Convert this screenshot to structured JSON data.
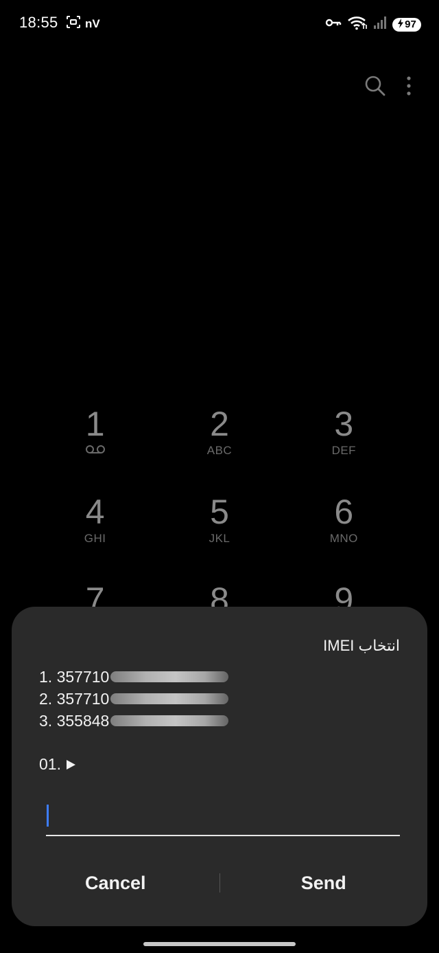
{
  "status_bar": {
    "time": "18:55",
    "network_badge": "nV",
    "battery_level": "97",
    "icons": [
      "screen-capture-icon",
      "vpn-key-icon",
      "wifi-icon",
      "signal-icon",
      "battery-icon",
      "charging-icon"
    ]
  },
  "top_actions": {
    "icons": [
      "search-icon",
      "more-options-icon"
    ]
  },
  "dialpad": {
    "keys": [
      {
        "digit": "1",
        "letters": ""
      },
      {
        "digit": "2",
        "letters": "ABC"
      },
      {
        "digit": "3",
        "letters": "DEF"
      },
      {
        "digit": "4",
        "letters": "GHI"
      },
      {
        "digit": "5",
        "letters": "JKL"
      },
      {
        "digit": "6",
        "letters": "MNO"
      },
      {
        "digit": "7",
        "letters": ""
      },
      {
        "digit": "8",
        "letters": ""
      },
      {
        "digit": "9",
        "letters": ""
      }
    ]
  },
  "dialog": {
    "title": "انتخاب IMEI",
    "imei_items": [
      "1. 357710",
      "2. 357710",
      "3. 355848"
    ],
    "prompt": "01.",
    "input_value": "",
    "cancel_label": "Cancel",
    "send_label": "Send"
  },
  "colors": {
    "background": "#000000",
    "dialog_background": "#2a2a2a",
    "cursor_accent": "#3d7dff"
  }
}
